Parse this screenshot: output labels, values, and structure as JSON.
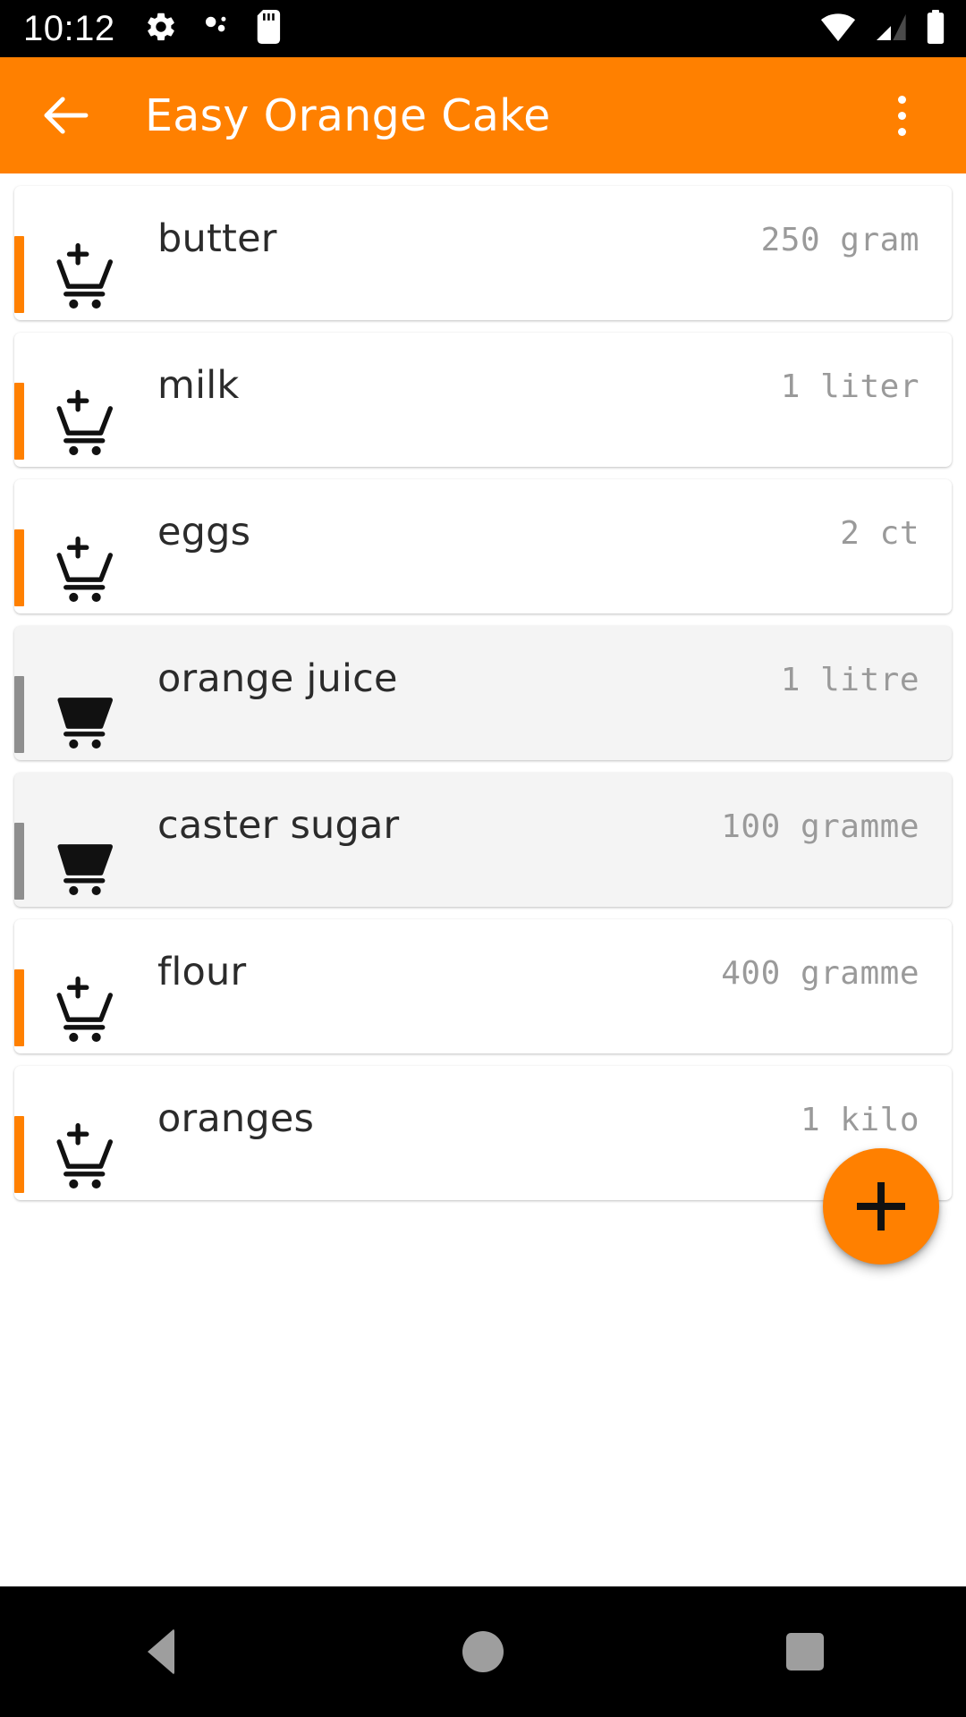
{
  "status_bar": {
    "time": "10:12",
    "left_icons": [
      "gear-icon",
      "debug-dots-icon",
      "sd-card-icon"
    ],
    "right_icons": [
      "wifi-icon",
      "cellular-signal-icon",
      "battery-icon"
    ],
    "background_color": "#000000"
  },
  "app_bar": {
    "back_label": "back-arrow",
    "title": "Easy Orange Cake",
    "overflow_label": "more-options",
    "background_color": "#FF8000",
    "title_color": "#FFFFFF"
  },
  "colors": {
    "accent_orange": "#FF8000",
    "accent_gray": "#8E8E8E",
    "card_white": "#FFFFFF",
    "card_done": "#F4F4F4",
    "quantity_text": "#9A9A9A",
    "name_text": "#2B2B2B"
  },
  "ingredients": [
    {
      "name": "butter",
      "quantity": "250 gram",
      "in_cart": false,
      "icon": "add-to-cart-icon"
    },
    {
      "name": "milk",
      "quantity": "1 liter",
      "in_cart": false,
      "icon": "add-to-cart-icon"
    },
    {
      "name": "eggs",
      "quantity": "2 ct",
      "in_cart": false,
      "icon": "add-to-cart-icon"
    },
    {
      "name": "orange juice",
      "quantity": "1 litre",
      "in_cart": true,
      "icon": "cart-filled-icon"
    },
    {
      "name": "caster sugar",
      "quantity": "100 gramme",
      "in_cart": true,
      "icon": "cart-filled-icon"
    },
    {
      "name": "flour",
      "quantity": "400 gramme",
      "in_cart": false,
      "icon": "add-to-cart-icon"
    },
    {
      "name": "oranges",
      "quantity": "1 kilo",
      "in_cart": false,
      "icon": "add-to-cart-icon"
    }
  ],
  "fab": {
    "label": "add-ingredient",
    "glyph": "+",
    "background_color": "#FF8000"
  },
  "nav_bar": {
    "buttons": [
      "back",
      "home",
      "recents"
    ],
    "background_color": "#000000",
    "icon_color": "#9E9E9E"
  }
}
